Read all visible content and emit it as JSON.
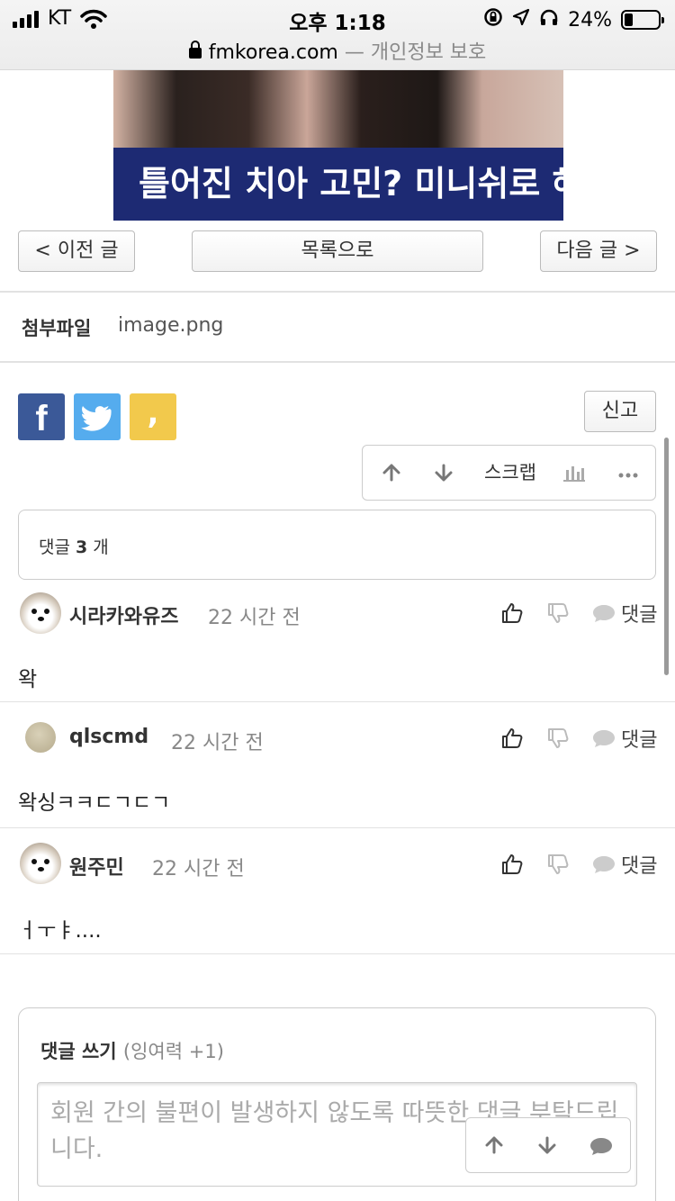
{
  "status_bar": {
    "carrier": "KT",
    "time": "오후 1:18",
    "battery": "24%",
    "battery_level": 0.24,
    "url": "fmkorea.com",
    "url_suffix": "— 개인정보 보호"
  },
  "ad": {
    "text": "틀어진 치아 고민? 미니쉬로 해"
  },
  "nav": {
    "prev": "< 이전 글",
    "list": "목록으로",
    "next": "다음 글 >"
  },
  "attachment": {
    "label": "첨부파일",
    "file": "image.png"
  },
  "share": {
    "facebook_glyph": "f",
    "kakao_glyph": ",",
    "report": "신고"
  },
  "post_toolbar": {
    "scrap": "스크랩"
  },
  "comments_header": {
    "prefix": "댓글",
    "count": "3",
    "suffix": "개"
  },
  "comments": [
    {
      "author": "시라카와유즈",
      "time": "22 시간 전",
      "reply": "댓글",
      "body": "왁"
    },
    {
      "author": "qlscmd",
      "time": "22 시간 전",
      "reply": "댓글",
      "body": "왁싱ㅋㅋㄷㄱㄷㄱ"
    },
    {
      "author": "원주민",
      "time": "22 시간 전",
      "reply": "댓글",
      "body": "ㅓㅜㅑ...."
    }
  ],
  "write_comment": {
    "title": "댓글 쓰기",
    "subtitle": "(잉여력 +1)",
    "placeholder": "회원 간의 불편이 발생하지 않도록 따뜻한 댓글 부탁드립니다."
  },
  "colors": {
    "facebook": "#3b5998",
    "twitter": "#55acee",
    "kakao": "#f2c94c",
    "ad_band": "#1d2a73"
  }
}
